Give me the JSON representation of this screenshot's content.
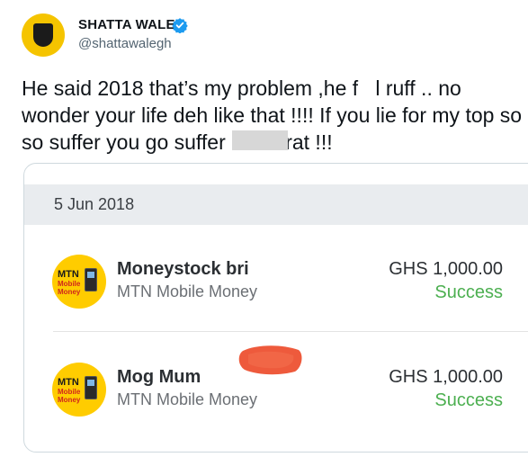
{
  "tweet": {
    "display_name": "SHATTA WALE",
    "handle": "@shattawalegh",
    "verified_icon": "verified-badge-icon",
    "text_lines": [
      "He said 2018 that’s my problem ,he fo l ruff .. no",
      "wonder your life deh like that !!!! If you lie for my top so",
      "so suffer you go suffer ..          like rat !!!"
    ]
  },
  "media": {
    "date": "5 Jun 2018",
    "transactions": [
      {
        "name": "Moneystock bri",
        "provider": "MTN Mobile Money",
        "amount": "GHS 1,000.00",
        "status": "Success",
        "logo_text": "MTN",
        "logo_subtext": "Mobile Money"
      },
      {
        "name": "Mog Mum",
        "provider": "MTN Mobile Money",
        "amount": "GHS 1,000.00",
        "status": "Success",
        "logo_text": "MTN",
        "logo_subtext": "Mobile Money"
      }
    ]
  },
  "colors": {
    "verified": "#1d9bf0",
    "success": "#4caf50",
    "mtn_yellow": "#ffcc00",
    "scribble": "#ee5a3c"
  }
}
